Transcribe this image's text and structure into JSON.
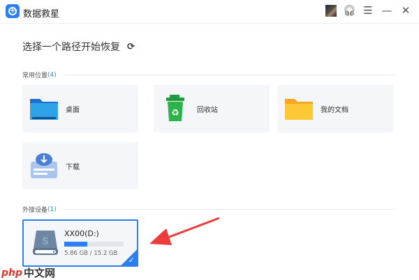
{
  "app": {
    "title": "数据救星"
  },
  "heading": "选择一个路径开始恢复",
  "common": {
    "label": "常用位置",
    "count": "(4)",
    "items": [
      {
        "label": "桌面"
      },
      {
        "label": "回收站"
      },
      {
        "label": "我的文档"
      },
      {
        "label": "下载"
      }
    ]
  },
  "external": {
    "label": "外接设备",
    "count": "(1)",
    "devices": [
      {
        "name": "XX00(D:)",
        "size": "5.86 GB / 15.2 GB",
        "used_fraction": 0.39,
        "selected": true
      }
    ]
  },
  "watermark": {
    "php": "php",
    "text": "中文网"
  },
  "colors": {
    "accent": "#2b7ff2",
    "arrow": "#ee3b3b"
  }
}
